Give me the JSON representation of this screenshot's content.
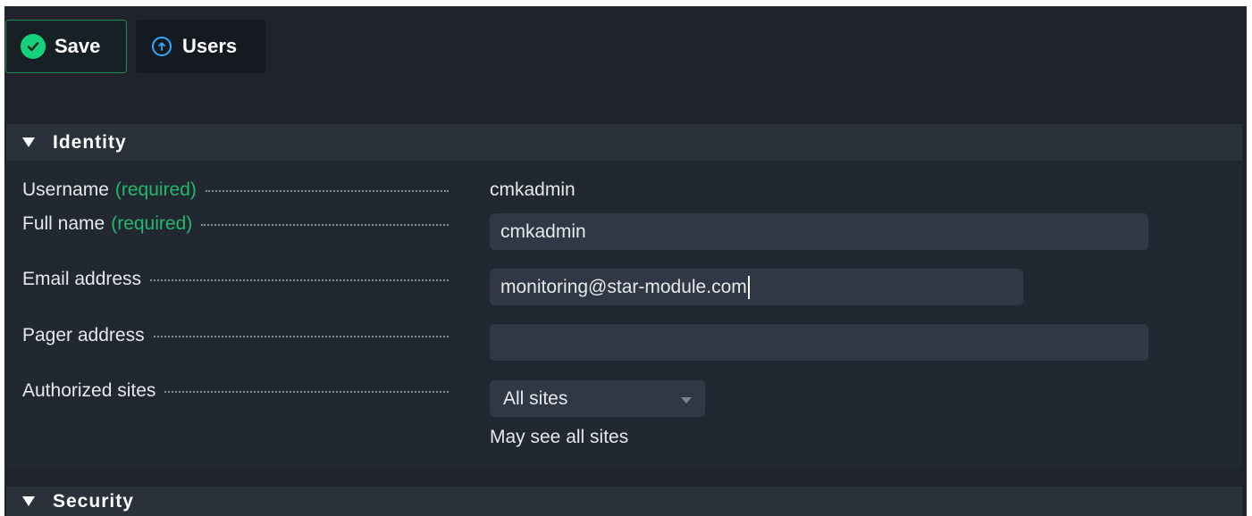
{
  "toolbar": {
    "save_label": "Save",
    "users_label": "Users",
    "save_icon": "check-circle-icon",
    "users_icon": "arrow-up-circle-icon"
  },
  "sections": {
    "identity": {
      "title": "Identity"
    },
    "security": {
      "title": "Security"
    }
  },
  "form": {
    "required_marker": "(required)",
    "username": {
      "label": "Username",
      "value": "cmkadmin"
    },
    "full_name": {
      "label": "Full name",
      "value": "cmkadmin"
    },
    "email": {
      "label": "Email address",
      "value": "monitoring@star-module.com"
    },
    "pager": {
      "label": "Pager address",
      "value": ""
    },
    "authorized_sites": {
      "label": "Authorized sites",
      "selected": "All sites",
      "help": "May see all sites"
    }
  },
  "colors": {
    "background": "#1e232c",
    "section_header": "#2a313b",
    "input_bg": "#303845",
    "required_green": "#22b86b",
    "save_icon_green": "#15d17a",
    "users_icon_blue": "#2fa8ff"
  }
}
